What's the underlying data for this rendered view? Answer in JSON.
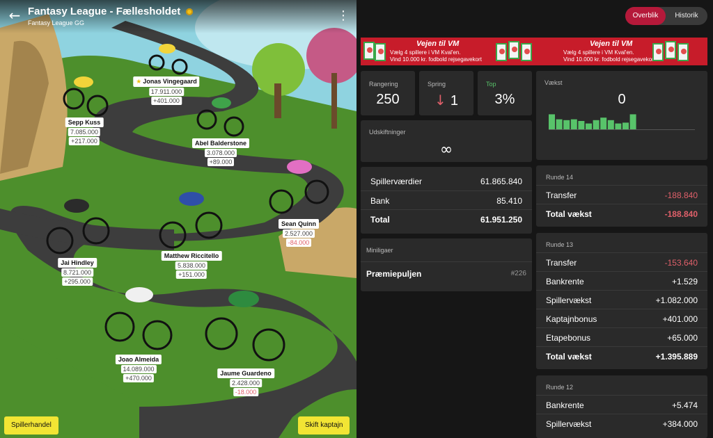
{
  "header": {
    "title": "Fantasy League - Fællesholdet",
    "subtitle": "Fantasy League GG"
  },
  "icons": {
    "back": "arrow-left-icon",
    "menu": "kebab-menu-icon",
    "coin": "coin-icon",
    "captain": "star-icon",
    "down_arrow": "arrow-down-icon",
    "infinity": "infinity-icon"
  },
  "riders": [
    {
      "name": "Jonas Vingegaard",
      "value": "17.911.000",
      "delta": "+401.000",
      "captain": true
    },
    {
      "name": "Sepp Kuss",
      "value": "7.085.000",
      "delta": "+217.000"
    },
    {
      "name": "Abel Balderstone",
      "value": "3.078.000",
      "delta": "+89.000"
    },
    {
      "name": "Sean Quinn",
      "value": "2.527.000",
      "delta": "-84.000"
    },
    {
      "name": "Jai Hindley",
      "value": "8.721.000",
      "delta": "+295.000"
    },
    {
      "name": "Matthew Riccitello",
      "value": "5.838.000",
      "delta": "+151.000"
    },
    {
      "name": "Joao Almeida",
      "value": "14.089.000",
      "delta": "+470.000"
    },
    {
      "name": "Jaume Guardeno",
      "value": "2.428.000",
      "delta": "-18.000"
    }
  ],
  "buttons": {
    "trade": "Spillerhandel",
    "captain": "Skift kaptajn"
  },
  "toggle": {
    "overview": "Overblik",
    "history": "Historik"
  },
  "banner": {
    "title": "Vejen til VM",
    "line1": "Vælg 4 spillere i VM Kval'en.",
    "line2": "Vind 10.000 kr. fodbold rejsegavekort"
  },
  "stats": {
    "rank_label": "Rangering",
    "rank_value": "250",
    "jump_label": "Spring",
    "jump_value": "1",
    "top_label": "Top",
    "top_value": "3%",
    "growth_label": "Vækst",
    "growth_value": "0",
    "subs_label": "Udskiftninger",
    "subs_value": "∞"
  },
  "growth_bars": [
    0.9,
    0.6,
    0.55,
    0.6,
    0.5,
    0.35,
    0.55,
    0.7,
    0.55,
    0.35,
    0.4,
    0.9
  ],
  "summary": [
    {
      "label": "Spillerværdier",
      "value": "61.865.840"
    },
    {
      "label": "Bank",
      "value": "85.410"
    },
    {
      "label": "Total",
      "value": "61.951.250",
      "bold": true
    }
  ],
  "minileagues": {
    "label": "Miniligaer",
    "name": "Præmiepuljen",
    "rank": "#226"
  },
  "rounds": [
    {
      "title": "Runde 14",
      "rows": [
        {
          "label": "Transfer",
          "value": "-188.840",
          "neg": true
        },
        {
          "label": "Total vækst",
          "value": "-188.840",
          "neg": true,
          "bold": true
        }
      ]
    },
    {
      "title": "Runde 13",
      "rows": [
        {
          "label": "Transfer",
          "value": "-153.640",
          "neg": true
        },
        {
          "label": "Bankrente",
          "value": "+1.529"
        },
        {
          "label": "Spillervækst",
          "value": "+1.082.000"
        },
        {
          "label": "Kaptajnbonus",
          "value": "+401.000"
        },
        {
          "label": "Etapebonus",
          "value": "+65.000"
        },
        {
          "label": "Total vækst",
          "value": "+1.395.889",
          "bold": true
        }
      ]
    },
    {
      "title": "Runde 12",
      "rows": [
        {
          "label": "Bankrente",
          "value": "+5.474"
        },
        {
          "label": "Spillervækst",
          "value": "+384.000"
        }
      ]
    }
  ]
}
